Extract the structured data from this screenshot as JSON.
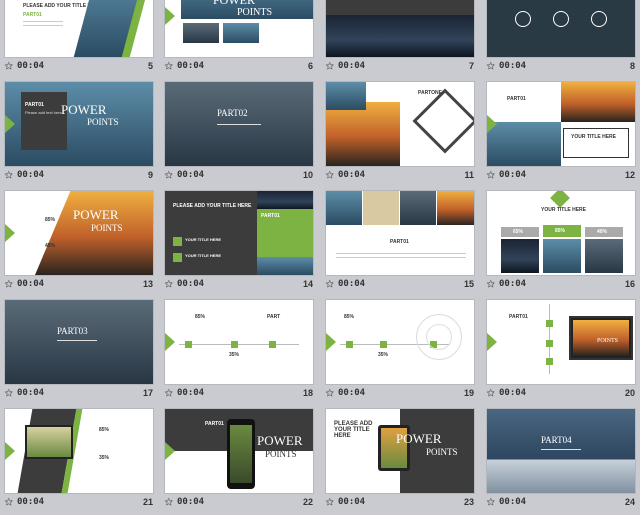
{
  "time_label": "00:04",
  "star_icon": "slide-transition-icon",
  "slides": [
    {
      "n": "5",
      "title": "PLEASE ADD YOUR TITLE HERE",
      "part": "PART01"
    },
    {
      "n": "6",
      "title": "POWER",
      "sub": "POINTS"
    },
    {
      "n": "7"
    },
    {
      "n": "8"
    },
    {
      "n": "9",
      "part": "PART01",
      "title": "POWER",
      "sub": "POINTS",
      "tag": "Please add text here"
    },
    {
      "n": "10",
      "part": "PART02"
    },
    {
      "n": "11",
      "part": "PARTONE"
    },
    {
      "n": "12",
      "part": "PART01",
      "title": "YOUR TITLE HERE"
    },
    {
      "n": "13",
      "title": "POWER",
      "sub": "POINTS",
      "p1": "85%",
      "p2": "45%"
    },
    {
      "n": "14",
      "title": "PLEASE ADD YOUR TITLE HERE",
      "part": "PART01",
      "item1": "YOUR TITLE HERE",
      "item2": "YOUR TITLE HERE"
    },
    {
      "n": "15",
      "part": "PART01"
    },
    {
      "n": "16",
      "title": "YOUR TITLE HERE",
      "p1": "65%",
      "p2": "85%",
      "p3": "40%"
    },
    {
      "n": "17",
      "part": "PART03"
    },
    {
      "n": "18",
      "p1": "85%",
      "p2": "35%",
      "part": "PART"
    },
    {
      "n": "19",
      "p1": "85%",
      "p2": "35%"
    },
    {
      "n": "20",
      "part": "PART01",
      "sub": "POINTS"
    },
    {
      "n": "21",
      "p1": "85%",
      "p2": "35%"
    },
    {
      "n": "22",
      "title": "POWER",
      "sub": "POINTS",
      "part": "PART01"
    },
    {
      "n": "23",
      "title": "PLEASE ADD YOUR TITLE HERE",
      "title2": "POWER",
      "sub": "POINTS"
    },
    {
      "n": "24",
      "part": "PART04"
    }
  ]
}
